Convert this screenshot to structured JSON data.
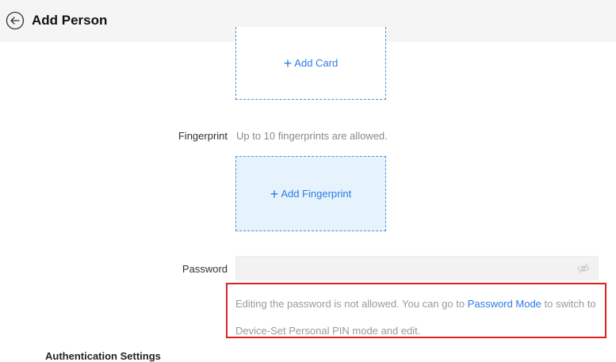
{
  "header": {
    "title": "Add Person",
    "back_icon": "circle-arrow-left-icon"
  },
  "card": {
    "add_label": "Add Card"
  },
  "fingerprint": {
    "label": "Fingerprint",
    "hint": "Up to 10 fingerprints are allowed.",
    "add_label": "Add Fingerprint"
  },
  "password": {
    "label": "Password",
    "value": "",
    "visibility_icon": "eye-off-icon"
  },
  "notice": {
    "text_before": "Editing the password is not allowed. You can go to ",
    "link": "Password Mode",
    "text_after": " to switch to Device-Set Personal PIN mode and edit."
  },
  "section": {
    "next_title": "Authentication Settings"
  },
  "colors": {
    "accent": "#2c7be5",
    "highlight_border": "#e02020",
    "fingerprint_bg": "#e6f3fd"
  }
}
